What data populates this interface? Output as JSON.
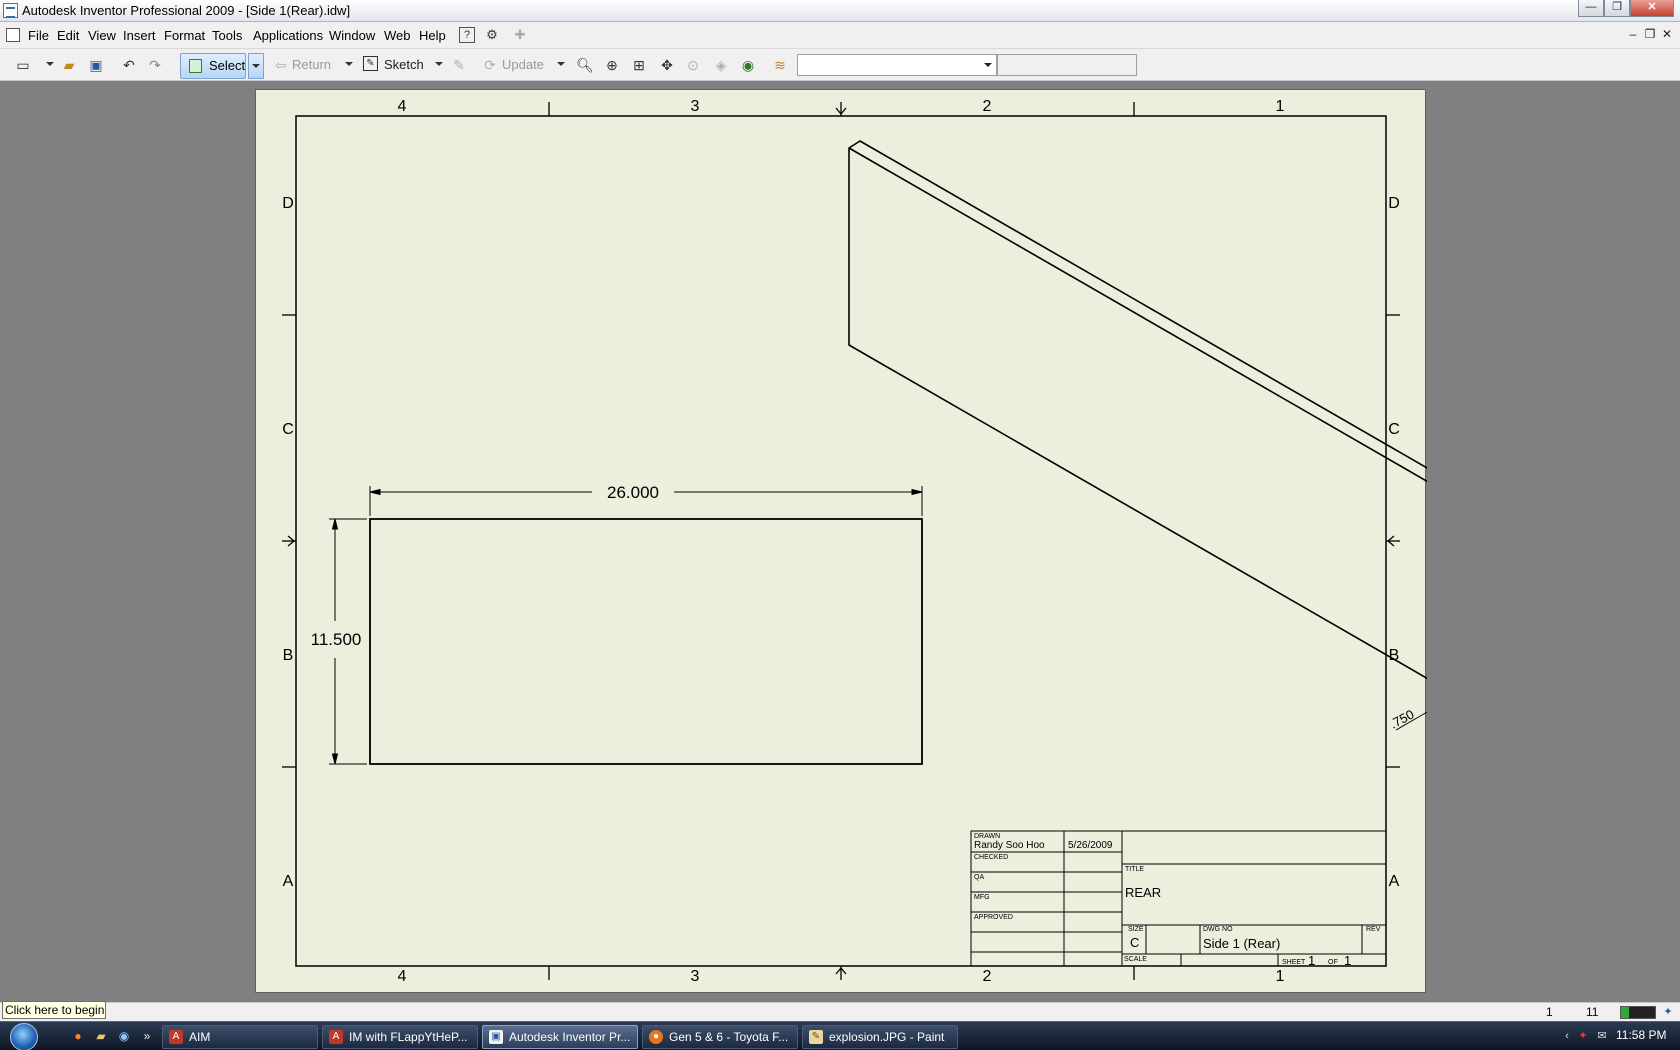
{
  "window": {
    "title": "Autodesk Inventor Professional 2009 - [Side 1(Rear).idw]",
    "controls": [
      "—",
      "❐",
      "✕"
    ]
  },
  "menu": {
    "items": [
      "File",
      "Edit",
      "View",
      "Insert",
      "Format",
      "Tools",
      "Applications",
      "Window",
      "Web",
      "Help"
    ],
    "mdi_controls": [
      "–",
      "❐",
      "✕"
    ]
  },
  "toolbar": {
    "select_label": "Select",
    "return_label": "Return",
    "sketch_label": "Sketch",
    "update_label": "Update",
    "style_value": "",
    "layer_value": ""
  },
  "drawing": {
    "zone_columns": [
      "4",
      "3",
      "2",
      "1"
    ],
    "zone_rows": [
      "D",
      "C",
      "B",
      "A"
    ],
    "dim_width": "26.000",
    "dim_height": "11.500",
    "dim_thickness": ".750",
    "title_block": {
      "drawn_label": "DRAWN",
      "drawn_by": "Randy Soo Hoo",
      "drawn_date": "5/26/2009",
      "checked_label": "CHECKED",
      "qa_label": "QA",
      "mfg_label": "MFG",
      "approved_label": "APPROVED",
      "title_label": "TITLE",
      "title": "REAR",
      "size_label": "SIZE",
      "size": "C",
      "dwg_no_label": "DWG NO",
      "dwg_no": "Side 1 (Rear)",
      "rev_label": "REV",
      "scale_label": "SCALE",
      "sheet_label": "SHEET",
      "sheet_num": "1",
      "of_label": "OF",
      "sheet_total": "1"
    }
  },
  "status": {
    "tooltip": "Click here to begin",
    "count1": "1",
    "count2": "11"
  },
  "taskbar": {
    "items": [
      {
        "label": "AIM",
        "icon": "aim-icon",
        "active": false
      },
      {
        "label": "IM with FLappYtHeP...",
        "icon": "aim-icon",
        "active": false
      },
      {
        "label": "Autodesk Inventor Pr...",
        "icon": "inventor-icon",
        "active": true
      },
      {
        "label": "Gen 5 & 6 - Toyota F...",
        "icon": "firefox-icon",
        "active": false
      },
      {
        "label": "explosion.JPG - Paint",
        "icon": "paint-icon",
        "active": false
      }
    ],
    "clock": "11:58 PM"
  }
}
